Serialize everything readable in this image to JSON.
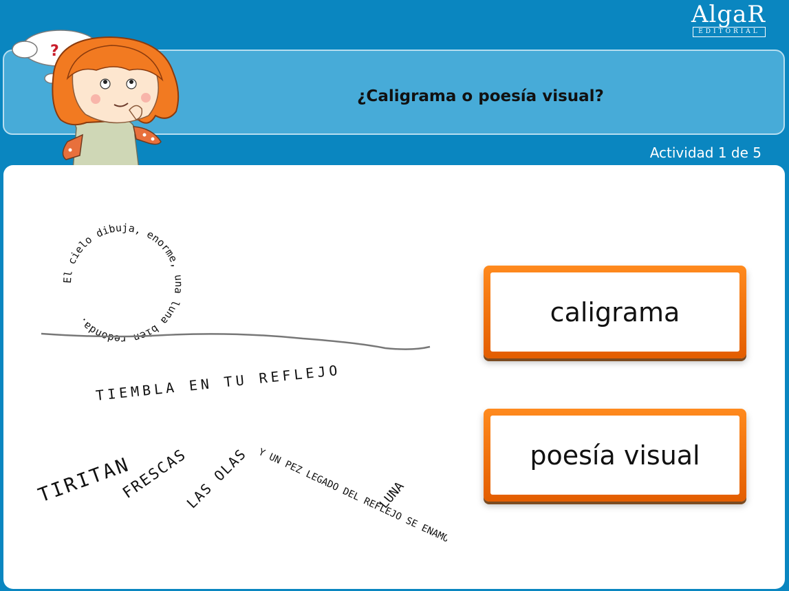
{
  "app": {
    "brand": "AlgaR",
    "brand_sub": "EDITORIAL",
    "title": "¿Caligrama o poesía visual?",
    "progress": "Actividad 1 de 5",
    "thought_symbol": "?"
  },
  "colors": {
    "background": "#0a86c0",
    "header_band": "#47abd8",
    "button_orange": "#ff7a12"
  },
  "poems": {
    "circle_text": "El cielo dibuja, enorme, una luna bien redonda.",
    "middle_text": "TIEMBLA EN TU REFLEJO",
    "bottom_words": [
      "TIRITAN",
      "FRESCAS",
      "LAS OLAS",
      "Y UN PEZ LEGADO DEL REFLEJO SE ENAMORA",
      "LUNA"
    ]
  },
  "answers": [
    {
      "label": "caligrama"
    },
    {
      "label": "poesía visual"
    }
  ],
  "icons": [
    "thought-bubble-icon",
    "girl-thinking-illustration",
    "algar-logo"
  ]
}
